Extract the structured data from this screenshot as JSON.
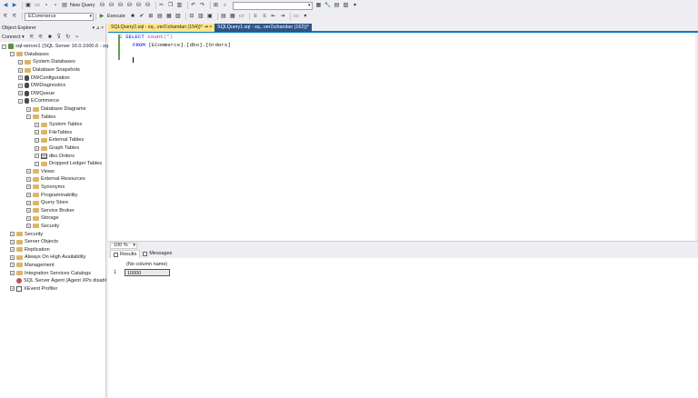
{
  "toolbar1": {
    "new_query": "New Query",
    "search_value": ""
  },
  "toolbar2": {
    "database": "ECommerce",
    "execute": "Execute"
  },
  "object_explorer": {
    "title": "Object Explorer",
    "controls": "▾ ⊿ ×",
    "connect": "Connect ▾",
    "tree": [
      {
        "label": "sql-server1 (SQL Server 16.0.1000.6 - sql",
        "level": 0,
        "exp": "-",
        "icon": "server"
      },
      {
        "label": "Databases",
        "level": 1,
        "exp": "-",
        "icon": "folder"
      },
      {
        "label": "System Databases",
        "level": 2,
        "exp": "+",
        "icon": "folder"
      },
      {
        "label": "Database Snapshots",
        "level": 2,
        "exp": "+",
        "icon": "folder"
      },
      {
        "label": "DWConfiguration",
        "level": 2,
        "exp": "+",
        "icon": "db"
      },
      {
        "label": "DWDiagnostics",
        "level": 2,
        "exp": "+",
        "icon": "db"
      },
      {
        "label": "DWQueue",
        "level": 2,
        "exp": "+",
        "icon": "db"
      },
      {
        "label": "ECommerce",
        "level": 2,
        "exp": "-",
        "icon": "db"
      },
      {
        "label": "Database Diagrams",
        "level": 3,
        "exp": "+",
        "icon": "folder"
      },
      {
        "label": "Tables",
        "level": 3,
        "exp": "-",
        "icon": "folder"
      },
      {
        "label": "System Tables",
        "level": 4,
        "exp": "+",
        "icon": "folder"
      },
      {
        "label": "FileTables",
        "level": 4,
        "exp": "+",
        "icon": "folder"
      },
      {
        "label": "External Tables",
        "level": 4,
        "exp": "+",
        "icon": "folder"
      },
      {
        "label": "Graph Tables",
        "level": 4,
        "exp": "+",
        "icon": "folder"
      },
      {
        "label": "dbo.Orders",
        "level": 4,
        "exp": "+",
        "icon": "table"
      },
      {
        "label": "Dropped Ledger Tables",
        "level": 4,
        "exp": "+",
        "icon": "folder"
      },
      {
        "label": "Views",
        "level": 3,
        "exp": "+",
        "icon": "folder"
      },
      {
        "label": "External Resources",
        "level": 3,
        "exp": "+",
        "icon": "folder"
      },
      {
        "label": "Synonyms",
        "level": 3,
        "exp": "+",
        "icon": "folder"
      },
      {
        "label": "Programmability",
        "level": 3,
        "exp": "+",
        "icon": "folder"
      },
      {
        "label": "Query Store",
        "level": 3,
        "exp": "+",
        "icon": "folder"
      },
      {
        "label": "Service Broker",
        "level": 3,
        "exp": "+",
        "icon": "folder"
      },
      {
        "label": "Storage",
        "level": 3,
        "exp": "+",
        "icon": "folder"
      },
      {
        "label": "Security",
        "level": 3,
        "exp": "+",
        "icon": "folder"
      },
      {
        "label": "Security",
        "level": 1,
        "exp": "+",
        "icon": "folder"
      },
      {
        "label": "Server Objects",
        "level": 1,
        "exp": "+",
        "icon": "folder"
      },
      {
        "label": "Replication",
        "level": 1,
        "exp": "+",
        "icon": "folder"
      },
      {
        "label": "Always On High Availability",
        "level": 1,
        "exp": "+",
        "icon": "folder"
      },
      {
        "label": "Management",
        "level": 1,
        "exp": "+",
        "icon": "folder"
      },
      {
        "label": "Integration Services Catalogs",
        "level": 1,
        "exp": "+",
        "icon": "folder"
      },
      {
        "label": "SQL Server Agent (Agent XPs disabl",
        "level": 1,
        "exp": "",
        "icon": "agent"
      },
      {
        "label": "XEvent Profiler",
        "level": 1,
        "exp": "+",
        "icon": "xe"
      }
    ]
  },
  "tabs": [
    {
      "label": "SQLQuery2.sql - sq...ver1\\chandan (154))*  ⇥  ×",
      "active": true
    },
    {
      "label": "SQLQuery1.sql - sq...ver1\\chandan (162))*",
      "active": false
    }
  ],
  "editor": {
    "line1_kw": "SELECT",
    "line1_fn": "count",
    "line1_rest": "(*)",
    "line2_kw": "FROM",
    "line2_obj": "[ECommerce].[dbo].[Orders]",
    "collapse": "⊟"
  },
  "zoom": "100 %",
  "results": {
    "tab_results": "Results",
    "tab_messages": "Messages",
    "column_header": "(No column name)",
    "row_number": "1",
    "value": "10000"
  },
  "colors": {
    "accent": "#007acc",
    "active_tab": "#ffe68a",
    "inactive_tab": "#2d5486",
    "keyword": "#0000ff"
  }
}
